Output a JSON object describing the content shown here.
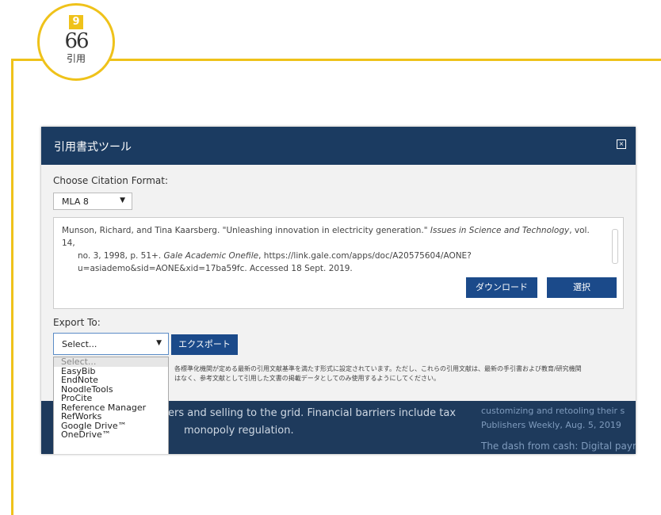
{
  "badge": {
    "number": "9",
    "quote_glyph": "66",
    "label": "引用"
  },
  "dialog": {
    "title": "引用書式ツール",
    "close_glyph": "×",
    "format_label": "Choose Citation Format:",
    "format_value": "MLA 8",
    "citation": {
      "line1_pre": "Munson, Richard, and Tina Kaarsberg. \"Unleashing innovation in electricity generation.\" ",
      "line1_journal": "Issues in Science and Technology",
      "line1_post": ", vol. 14,",
      "line2_pre": "no. 3, 1998, p. 51+. ",
      "line2_source": "Gale Academic Onefile",
      "line2_post": ", https://link.gale.com/apps/doc/A20575604/AONE?",
      "line3": "u=asiademo&sid=AONE&xid=17ba59fc. Accessed 18 Sept. 2019."
    },
    "download_label": "ダウンロード",
    "select_label": "選択",
    "export_label": "Export To:",
    "export_value": "Select...",
    "export_button": "エクスポート",
    "export_options": [
      "Select...",
      "EasyBib",
      "EndNote",
      "NoodleTools",
      "ProCite",
      "Reference Manager",
      "RefWorks",
      "Google Drive™",
      "OneDrive™"
    ],
    "notice_line1": "各標準化機関が定める最新の引用文献基準を満たす形式に設定されています。ただし、これらの引用文献は、最新の手引書および教育/研究機関",
    "notice_line2": "はなく、参考文献として引用した文書の掲載データとしてのみ使用するようにしてください。"
  },
  "background": {
    "line1": "ers and selling to the grid. Financial barriers include tax",
    "line2": "monopoly regulation.",
    "right1": "customizing and retooling their s",
    "right2": "Publishers Weekly, Aug. 5, 2019",
    "right3": "The dash from cash: Digital paym"
  }
}
